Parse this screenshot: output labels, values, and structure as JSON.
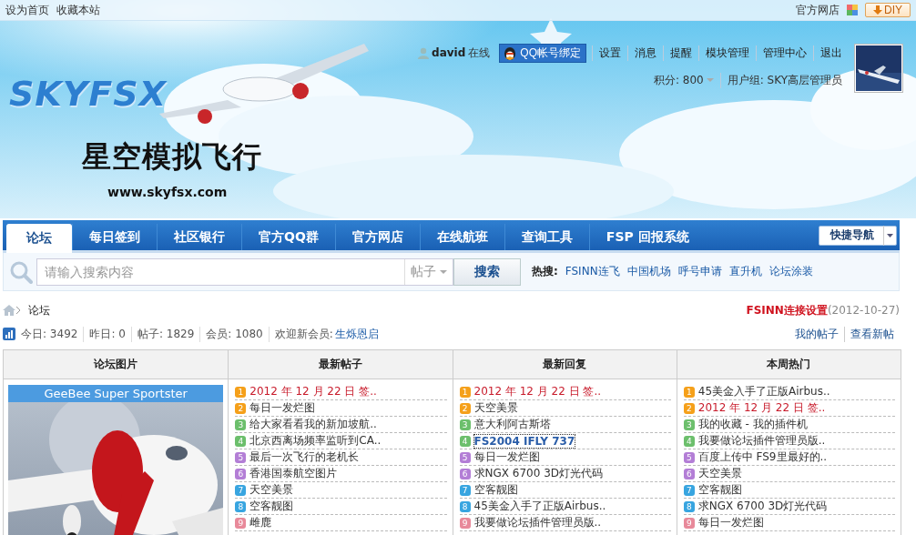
{
  "top_bar": {
    "links": [
      "设为首页",
      "收藏本站"
    ],
    "shop_link": "官方网店",
    "diy_button": "DIY"
  },
  "banner": {
    "logo": "SKYFSX",
    "site_name": "星空模拟飞行",
    "site_url": "www.skyfsx.com"
  },
  "user_panel": {
    "username": "david",
    "status": "在线",
    "qq_bind_button": "QQ帐号绑定",
    "links": [
      "设置",
      "消息",
      "提醒",
      "模块管理",
      "管理中心",
      "退出"
    ],
    "points": "积分: 800",
    "group": "用户组: SKY高层管理员"
  },
  "nav": {
    "tabs": [
      {
        "label": "论坛",
        "selected": true
      },
      {
        "label": "每日签到",
        "selected": false
      },
      {
        "label": "社区银行",
        "selected": false
      },
      {
        "label": "官方QQ群",
        "selected": false
      },
      {
        "label": "官方网店",
        "selected": false
      },
      {
        "label": "在线航班",
        "selected": false
      },
      {
        "label": "查询工具",
        "selected": false
      },
      {
        "label": "FSP 回报系统",
        "selected": false
      }
    ],
    "quick_nav": "快捷导航"
  },
  "search": {
    "placeholder": "请输入搜索内容",
    "scope": "帖子",
    "button": "搜索",
    "hot_label": "热搜:",
    "hot_links": [
      "FSINN连飞",
      "中国机场",
      "呼号申请",
      "直升机",
      "论坛涂装"
    ]
  },
  "breadcrumb": {
    "current": "论坛",
    "notice": "FSINN连接设置",
    "notice_date": "(2012-10-27)"
  },
  "stats": {
    "items": [
      "今日: 3492",
      "昨日: 0",
      "帖子: 1829",
      "会员: 1080"
    ],
    "welcome": "欢迎新会员:",
    "new_member": "生烁恩启",
    "links": [
      "我的帖子",
      "查看新帖"
    ]
  },
  "portal": {
    "picture_column": {
      "heading": "论坛图片",
      "caption": "GeeBee Super Sportster"
    },
    "lists": [
      {
        "heading": "最新帖子",
        "items": [
          {
            "rank": "1",
            "color": "#f5a01a",
            "title": "2012 年 12 月 22 日 签..",
            "kind": "hot"
          },
          {
            "rank": "2",
            "color": "#f5a01a",
            "title": "每日一发烂图",
            "kind": "normal"
          },
          {
            "rank": "3",
            "color": "#6cbf6c",
            "title": "给大家看看我的新加坡航..",
            "kind": "normal"
          },
          {
            "rank": "4",
            "color": "#6cbf6c",
            "title": "北京西离场频率监听到CA..",
            "kind": "normal"
          },
          {
            "rank": "5",
            "color": "#b37ed6",
            "title": "最后一次飞行的老机长",
            "kind": "normal"
          },
          {
            "rank": "6",
            "color": "#b37ed6",
            "title": "香港国泰航空图片",
            "kind": "normal"
          },
          {
            "rank": "7",
            "color": "#38a5e0",
            "title": "天空美景",
            "kind": "normal"
          },
          {
            "rank": "8",
            "color": "#38a5e0",
            "title": "空客靓图",
            "kind": "normal"
          },
          {
            "rank": "9",
            "color": "#e8899a",
            "title": "雌鹿",
            "kind": "normal"
          }
        ]
      },
      {
        "heading": "最新回复",
        "items": [
          {
            "rank": "1",
            "color": "#f5a01a",
            "title": "2012 年 12 月 22 日 签..",
            "kind": "hot"
          },
          {
            "rank": "2",
            "color": "#f5a01a",
            "title": "天空美景",
            "kind": "normal"
          },
          {
            "rank": "3",
            "color": "#6cbf6c",
            "title": "意大利阿古斯塔",
            "kind": "normal"
          },
          {
            "rank": "4",
            "color": "#6cbf6c",
            "title": "FS2004 IFLY 737",
            "kind": "focused"
          },
          {
            "rank": "5",
            "color": "#b37ed6",
            "title": "每日一发烂图",
            "kind": "normal"
          },
          {
            "rank": "6",
            "color": "#b37ed6",
            "title": "求NGX 6700 3D灯光代码",
            "kind": "normal"
          },
          {
            "rank": "7",
            "color": "#38a5e0",
            "title": "空客靓图",
            "kind": "normal"
          },
          {
            "rank": "8",
            "color": "#38a5e0",
            "title": "45美金入手了正版Airbus..",
            "kind": "normal"
          },
          {
            "rank": "9",
            "color": "#e8899a",
            "title": "我要做论坛插件管理员版..",
            "kind": "normal"
          }
        ]
      },
      {
        "heading": "本周热门",
        "items": [
          {
            "rank": "1",
            "color": "#f5a01a",
            "title": "45美金入手了正版Airbus..",
            "kind": "normal"
          },
          {
            "rank": "2",
            "color": "#f5a01a",
            "title": "2012 年 12 月 22 日 签..",
            "kind": "hot"
          },
          {
            "rank": "3",
            "color": "#6cbf6c",
            "title": "我的收藏 - 我的插件机",
            "kind": "normal"
          },
          {
            "rank": "4",
            "color": "#6cbf6c",
            "title": "我要做论坛插件管理员版..",
            "kind": "normal"
          },
          {
            "rank": "5",
            "color": "#b37ed6",
            "title": "百度上传中 FS9里最好的..",
            "kind": "normal"
          },
          {
            "rank": "6",
            "color": "#b37ed6",
            "title": "天空美景",
            "kind": "normal"
          },
          {
            "rank": "7",
            "color": "#38a5e0",
            "title": "空客靓图",
            "kind": "normal"
          },
          {
            "rank": "8",
            "color": "#38a5e0",
            "title": "求NGX 6700 3D灯光代码",
            "kind": "normal"
          },
          {
            "rank": "9",
            "color": "#e8899a",
            "title": "每日一发烂图",
            "kind": "normal"
          }
        ]
      }
    ]
  }
}
